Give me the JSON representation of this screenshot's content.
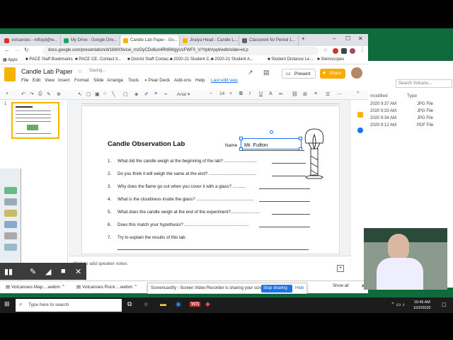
{
  "browser": {
    "tabs": [
      {
        "label": "volcanoes - mfloyd@w...",
        "color": "#d93025"
      },
      {
        "label": "My Drive - Google Driv...",
        "color": "#1fa463"
      },
      {
        "label": "Candle Lab Paper - Go...",
        "color": "#f4b400"
      },
      {
        "label": "Jiraiya Head - Candle L...",
        "color": "#f4b400"
      },
      {
        "label": "Classwork for Period 1...",
        "color": "#5f6368"
      }
    ],
    "url": "docs.google.com/presentation/d/16MXNvcw_rnzOyCDv8un4Rh6WgyUcFWF0_V/YlpbVyq4/edit#slide=id.p",
    "bookmarks": [
      "Apps",
      "PACE Staff Bookmarks",
      "PACE CE- Contact ll...",
      "District Staff Contac...",
      "2020-21 Student C...",
      "2020-21 Student A...",
      "Student Distance Le...",
      "Stemscopes"
    ]
  },
  "doc": {
    "title": "Candle Lab Paper",
    "status": "Saving...",
    "menus": [
      "File",
      "Edit",
      "View",
      "Insert",
      "Format",
      "Slide",
      "Arrange",
      "Tools",
      "Pear Deck",
      "Add-ons",
      "Help"
    ],
    "last_edit": "Last edit was",
    "present_label": "Present",
    "share_label": "Share",
    "font": "Arial",
    "font_size": "14",
    "speaker_notes": "Click to add speaker notes"
  },
  "slide": {
    "heading": "Candle Observation Lab",
    "name_label": "Name",
    "name_value": "Mr. Fulton",
    "questions": [
      {
        "n": "1.",
        "text": "What did the candle weigh at the beginning of the lab? ..........................."
      },
      {
        "n": "2.",
        "text": "Do you think it will weigh the same at the end? ......................................."
      },
      {
        "n": "3.",
        "text": "Why does the flame go out when you cover it with a glass? ..........."
      },
      {
        "n": "4.",
        "text": "What is the cloudiness inside the glass? ..............................................."
      },
      {
        "n": "5.",
        "text": "What does the candle weigh at the end of the experiment?........................"
      },
      {
        "n": "6.",
        "text": "Does this match your hypothesis? ....................................................."
      },
      {
        "n": "7.",
        "text": "Try to explain the results of this lab:"
      }
    ]
  },
  "explorer": {
    "search_placeholder": "Search Volcano...",
    "col_modified": "modified",
    "col_type": "Type",
    "rows": [
      {
        "date": "2020 9:37 AM",
        "type": "JPG File"
      },
      {
        "date": "2020 9:33 AM",
        "type": "JPG File"
      },
      {
        "date": "2020 9:34 AM",
        "type": "JPG File"
      },
      {
        "date": "2020 9:12 AM",
        "type": "PDF File"
      }
    ]
  },
  "downloads": {
    "items": [
      "Volcanoes Map....webm",
      "Volcanoes Rock....webm"
    ],
    "show_all": "Show all"
  },
  "screencastify": {
    "message": "Screencastify - Screen Video Recorder is sharing your screen.",
    "stop": "Stop sharing",
    "hide": "Hide"
  },
  "taskbar": {
    "search_placeholder": "Type here to search",
    "time": "10:46 AM",
    "date": "10/2/2020"
  }
}
